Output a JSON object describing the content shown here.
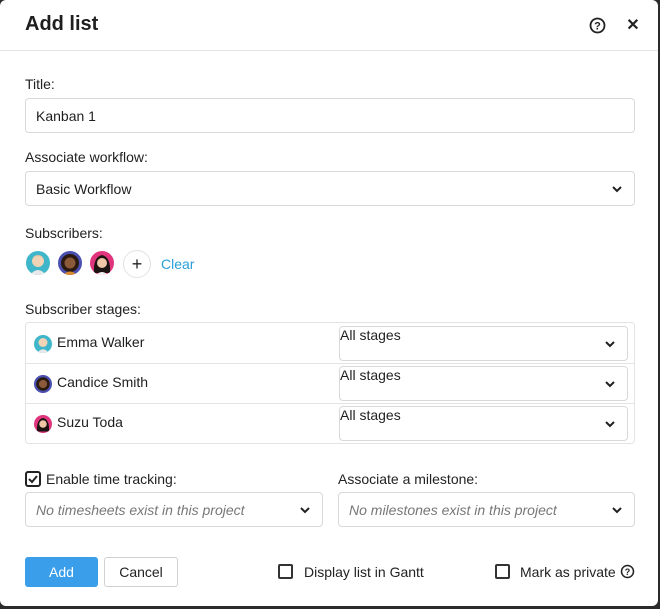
{
  "dialog": {
    "title": "Add list"
  },
  "form": {
    "title_label": "Title:",
    "title_value": "Kanban 1",
    "workflow_label": "Associate workflow:",
    "workflow_value": "Basic Workflow",
    "subscribers_label": "Subscribers:",
    "add_symbol": "+",
    "clear_label": "Clear",
    "stages_label": "Subscriber stages:",
    "stages": [
      {
        "name": "Emma Walker",
        "stage": "All stages"
      },
      {
        "name": "Candice Smith",
        "stage": "All stages"
      },
      {
        "name": "Suzu Toda",
        "stage": "All stages"
      }
    ],
    "time_tracking_label": "Enable time tracking:",
    "time_tracking_checked": true,
    "timesheets_placeholder": "No timesheets exist in this project",
    "milestone_label": "Associate a milestone:",
    "milestone_placeholder": "No milestones exist in this project"
  },
  "footer": {
    "add_label": "Add",
    "cancel_label": "Cancel",
    "gantt_label": "Display list in Gantt",
    "private_label": "Mark as private"
  },
  "colors": {
    "accent": "#3b9eea",
    "link": "#2a9fd8"
  }
}
